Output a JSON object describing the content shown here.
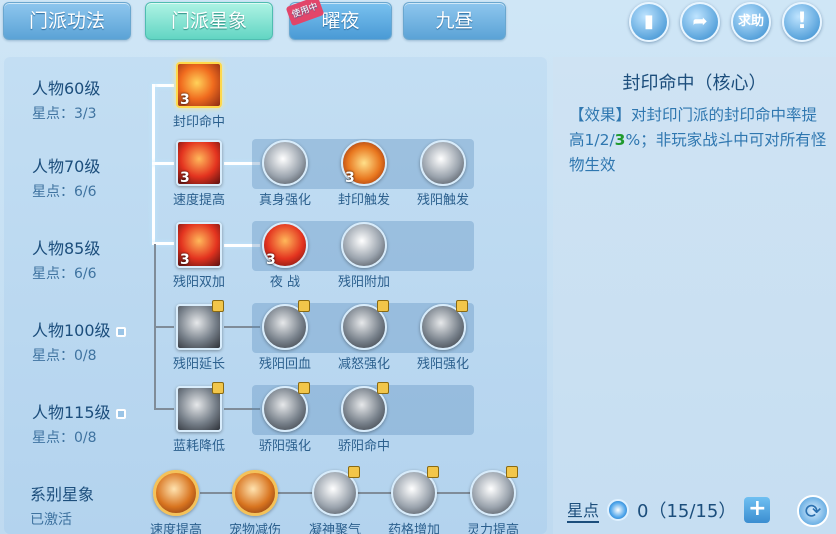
{
  "tabs": [
    {
      "label": "门派功法"
    },
    {
      "label": "门派星象"
    },
    {
      "label": "曜夜",
      "badge": "使用中"
    },
    {
      "label": "九昼"
    }
  ],
  "top_buttons": {
    "help": "求助",
    "info": "!"
  },
  "rows": [
    {
      "level": "人物60级",
      "points": "星点：3/3",
      "locked": false
    },
    {
      "level": "人物70级",
      "points": "星点：6/6",
      "locked": false
    },
    {
      "level": "人物85级",
      "points": "星点：6/6",
      "locked": false
    },
    {
      "level": "人物100级",
      "points": "星点：0/8",
      "locked": true
    },
    {
      "level": "人物115级",
      "points": "星点：0/8",
      "locked": true
    }
  ],
  "skills": {
    "r1": [
      {
        "name": "封印命中",
        "count": "3"
      }
    ],
    "r2": [
      {
        "name": "速度提高",
        "count": "3"
      },
      {
        "name": "真身强化",
        "count": ""
      },
      {
        "name": "封印触发",
        "count": "3"
      },
      {
        "name": "残阳触发",
        "count": ""
      }
    ],
    "r3": [
      {
        "name": "残阳双加",
        "count": "3"
      },
      {
        "name": "夜 战",
        "count": "3"
      },
      {
        "name": "残阳附加",
        "count": ""
      }
    ],
    "r4": [
      {
        "name": "残阳延长"
      },
      {
        "name": "残阳回血"
      },
      {
        "name": "减怒强化"
      },
      {
        "name": "残阳强化"
      }
    ],
    "r5": [
      {
        "name": "蓝耗降低"
      },
      {
        "name": "骄阳强化"
      },
      {
        "name": "骄阳命中"
      }
    ],
    "faction": [
      {
        "name": "速度提高"
      },
      {
        "name": "宠物减伤"
      },
      {
        "name": "凝神聚气"
      },
      {
        "name": "药格增加"
      },
      {
        "name": "灵力提高"
      }
    ]
  },
  "faction_row": {
    "title": "系别星象",
    "status": "已激活"
  },
  "detail": {
    "title": "封印命中（核心）",
    "desc_prefix": "【效果】对封印门派的封印命中率提高1/2/",
    "desc_highlight": "3",
    "desc_suffix": "%；非玩家战斗中可对所有怪物生效"
  },
  "star_points": {
    "label": "星点",
    "value": "0（15/15）"
  }
}
